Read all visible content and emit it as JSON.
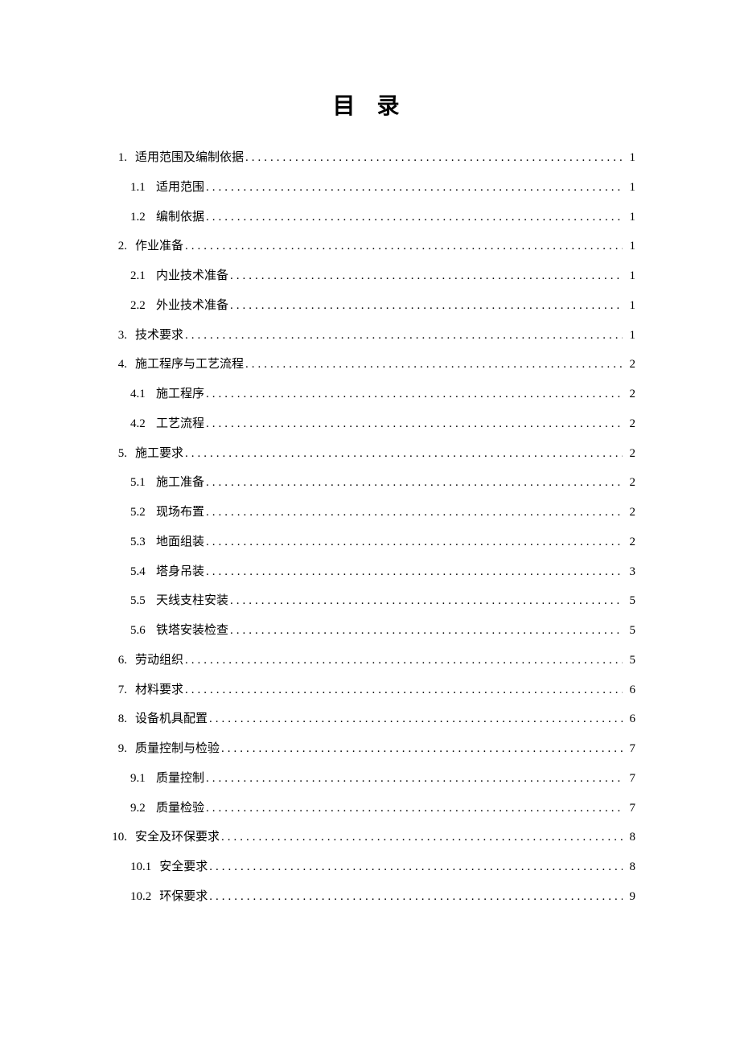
{
  "title": "目 录",
  "entries": [
    {
      "level": 1,
      "num": "1.",
      "text": "适用范围及编制依据",
      "page": "1"
    },
    {
      "level": 2,
      "num": "1.1",
      "text": "适用范围",
      "page": "1"
    },
    {
      "level": 2,
      "num": "1.2",
      "text": "编制依据",
      "page": "1"
    },
    {
      "level": 1,
      "num": "2.",
      "text": "作业准备",
      "page": "1"
    },
    {
      "level": 2,
      "num": "2.1",
      "text": "内业技术准备",
      "page": "1"
    },
    {
      "level": 2,
      "num": "2.2",
      "text": "外业技术准备",
      "page": "1"
    },
    {
      "level": 1,
      "num": "3.",
      "text": "技术要求",
      "page": "1"
    },
    {
      "level": 1,
      "num": "4.",
      "text": "施工程序与工艺流程",
      "page": "2"
    },
    {
      "level": 2,
      "num": "4.1",
      "text": "施工程序",
      "page": "2"
    },
    {
      "level": 2,
      "num": "4.2",
      "text": "工艺流程",
      "page": "2"
    },
    {
      "level": 1,
      "num": "5.",
      "text": "施工要求",
      "page": "2"
    },
    {
      "level": 2,
      "num": "5.1",
      "text": "施工准备",
      "page": "2"
    },
    {
      "level": 2,
      "num": "5.2",
      "text": "现场布置",
      "page": "2"
    },
    {
      "level": 2,
      "num": "5.3",
      "text": "地面组装",
      "page": "2"
    },
    {
      "level": 2,
      "num": "5.4",
      "text": "塔身吊装",
      "page": "3"
    },
    {
      "level": 2,
      "num": "5.5",
      "text": "天线支柱安装",
      "page": "5"
    },
    {
      "level": 2,
      "num": "5.6",
      "text": "铁塔安装检查",
      "page": "5"
    },
    {
      "level": 1,
      "num": "6.",
      "text": "劳动组织",
      "page": "5"
    },
    {
      "level": 1,
      "num": "7.",
      "text": "材料要求",
      "page": "6"
    },
    {
      "level": 1,
      "num": "8.",
      "text": "设备机具配置",
      "page": "6"
    },
    {
      "level": 1,
      "num": "9.",
      "text": "质量控制与检验",
      "page": "7"
    },
    {
      "level": 2,
      "num": "9.1",
      "text": "质量控制",
      "page": "7"
    },
    {
      "level": 2,
      "num": "9.2",
      "text": "质量检验",
      "page": "7"
    },
    {
      "level": 1,
      "num": "10.",
      "text": "安全及环保要求",
      "page": "8"
    },
    {
      "level": 2,
      "num": "10.1",
      "text": "安全要求",
      "page": "8"
    },
    {
      "level": 2,
      "num": "10.2",
      "text": "环保要求",
      "page": "9"
    }
  ]
}
